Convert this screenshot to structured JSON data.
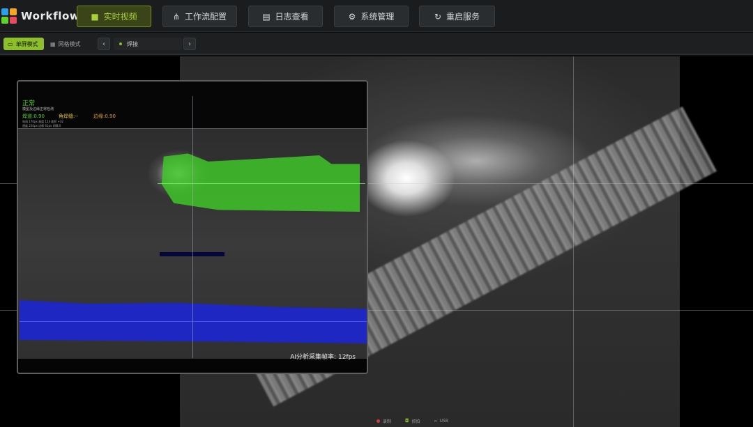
{
  "app": {
    "title": "Workflow",
    "logo_colors": [
      "#2f9ee8",
      "#f5a623",
      "#5fd32a",
      "#e84a5f"
    ]
  },
  "nav": [
    {
      "label": "实时视频",
      "icon": "video-camera-icon",
      "glyph": "■",
      "active": true
    },
    {
      "label": "工作流配置",
      "icon": "workflow-tree-icon",
      "glyph": "⋔",
      "active": false
    },
    {
      "label": "日志查看",
      "icon": "document-icon",
      "glyph": "▤",
      "active": false
    },
    {
      "label": "系统管理",
      "icon": "gear-icon",
      "glyph": "⚙",
      "active": false
    },
    {
      "label": "重启服务",
      "icon": "restart-icon",
      "glyph": "↻",
      "active": false
    }
  ],
  "toolbar": {
    "mode_single": "单屏模式",
    "mode_grid": "网格模式",
    "prev": "‹",
    "next": "›",
    "camera": "焊接"
  },
  "overlay": {
    "status": "正常",
    "description": "模型及边缘正常检测",
    "weld_metric": "焊道:0.90",
    "corner_metric": "角焊缝:--",
    "edge_metric": "边缘:0.90",
    "params_line1": "电流 170px 高度 124 面积 +32",
    "params_line2": "速度 220px 边缘 61px 间隔 0",
    "fps_label": "AI分析采集帧率:",
    "fps_value": "12fps"
  },
  "status_bar": {
    "recording": "录制",
    "capture": "抓拍",
    "usb": "USB"
  },
  "colors": {
    "accent": "#8dbf2d",
    "mask_weld": "#3fc428",
    "mask_edge": "#1c26d2",
    "ok_text": "#5fd32a"
  }
}
